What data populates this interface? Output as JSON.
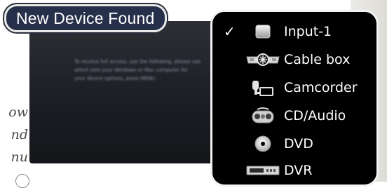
{
  "dialog": {
    "title": "New Device Found"
  },
  "caption_fragments": [
    "ow",
    "nd",
    "nu"
  ],
  "screen_text_lines": [
    "To receive full access, use the following, please use",
    "which sets your Windows or Mac computer for",
    "your device options, press MENU"
  ],
  "menu": {
    "checked_index": 0,
    "check_glyph": "✓",
    "items": [
      {
        "label": "Input-1",
        "icon": "input-icon"
      },
      {
        "label": "Cable box",
        "icon": "cable-box-icon"
      },
      {
        "label": "Camcorder",
        "icon": "camcorder-icon"
      },
      {
        "label": "CD/Audio",
        "icon": "cd-audio-icon"
      },
      {
        "label": "DVD",
        "icon": "dvd-icon"
      },
      {
        "label": "DVR",
        "icon": "dvr-icon"
      }
    ]
  }
}
